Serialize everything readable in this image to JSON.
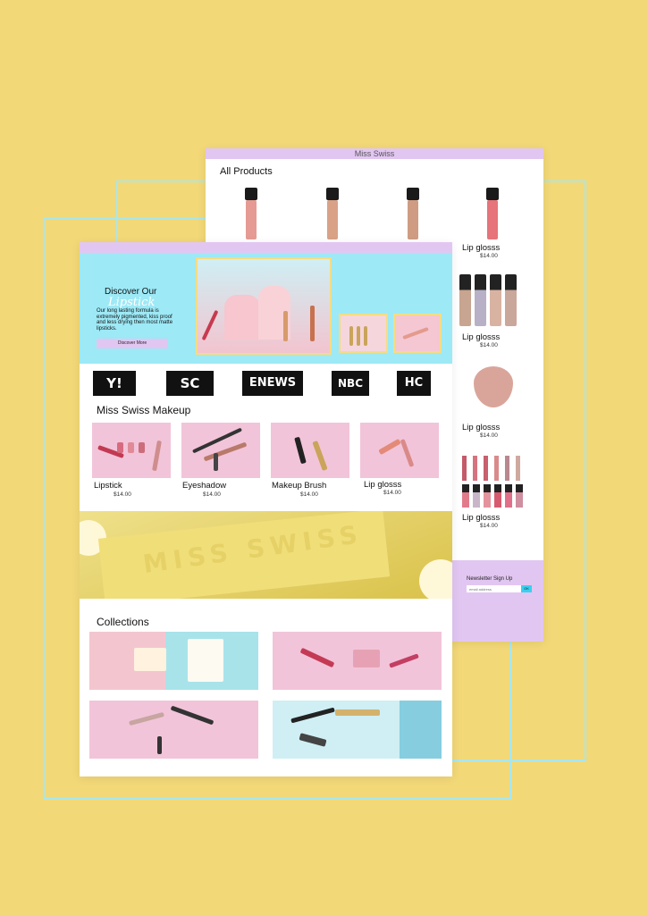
{
  "back_page": {
    "brand": "Miss Swiss",
    "heading": "All Products",
    "products": [
      {
        "label": "Lip glosss",
        "price": "$14.00"
      },
      {
        "label": "Lip glosss",
        "price": "$14.00"
      },
      {
        "label": "Lip glosss",
        "price": "$14.00"
      },
      {
        "label": "Lip glosss",
        "price": "$14.00"
      }
    ],
    "newsletter": {
      "title": "Newsletter Sign Up",
      "placeholder": "email address",
      "button": "OK"
    }
  },
  "front_page": {
    "hero": {
      "title": "Discover Our",
      "script": "Lipstick",
      "copy": "Our long lasting formula is extremely pigmented, kiss proof and less drying then most matte lipsticks.",
      "button": "Discover More"
    },
    "press_logos": [
      "Y!",
      "SC",
      "ENEWS",
      "NBC",
      "HC"
    ],
    "makeup_heading": "Miss Swiss Makeup",
    "categories": [
      {
        "label": "Lipstick",
        "price": "$14.00"
      },
      {
        "label": "Eyeshadow",
        "price": "$14.00"
      },
      {
        "label": "Makeup Brush",
        "price": "$14.00"
      },
      {
        "label": "Lip glosss",
        "price": "$14.00"
      }
    ],
    "banner_text": "MISS SWISS",
    "collections_heading": "Collections"
  },
  "colors": {
    "background": "#f2d877",
    "lavender": "#e2c6f2",
    "aqua": "#9de9f6",
    "pink": "#f2c4d9"
  }
}
